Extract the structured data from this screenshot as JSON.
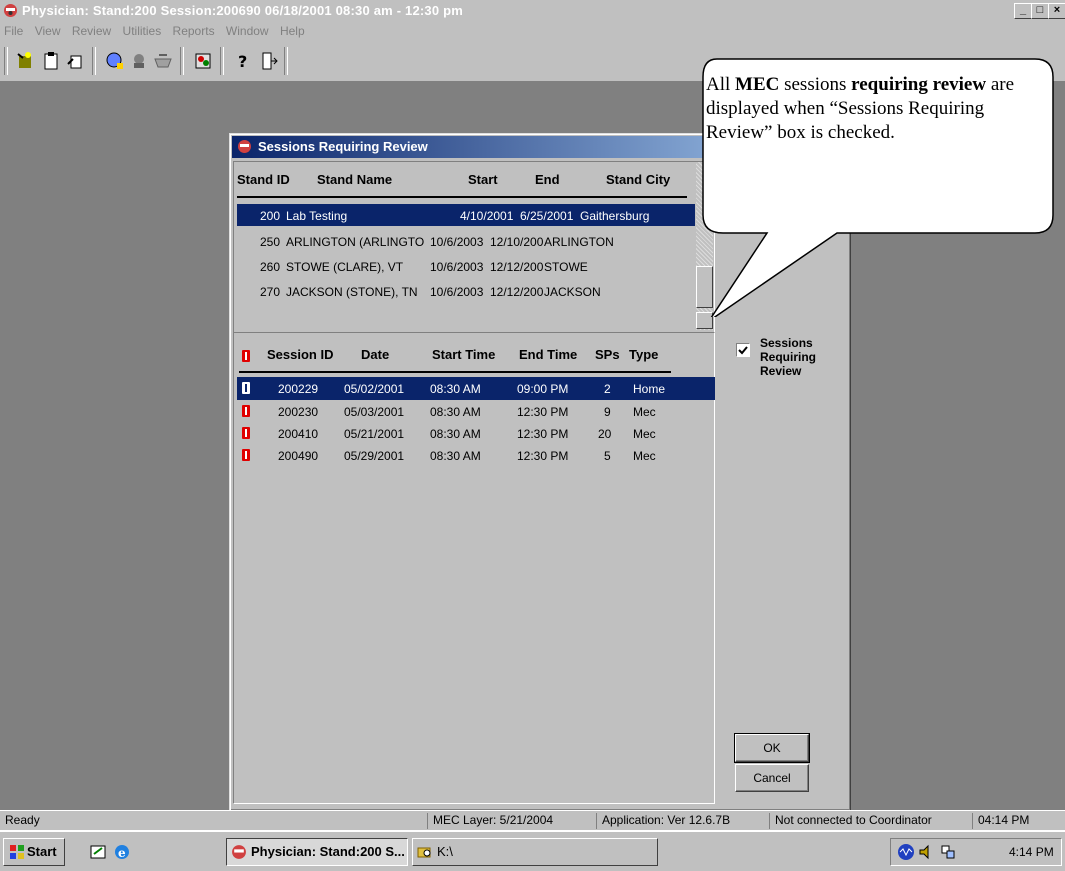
{
  "window": {
    "title": "Physician: Stand:200 Session:200690 06/18/2001 08:30 am - 12:30 pm",
    "min": "_",
    "max": "□",
    "close": "×"
  },
  "menu": [
    "File",
    "View",
    "Review",
    "Utilities",
    "Reports",
    "Window",
    "Help"
  ],
  "dialog": {
    "title": "Sessions Requiring Review",
    "stand_headers": [
      "Stand ID",
      "Stand Name",
      "Start",
      "End",
      "Stand City"
    ],
    "stands": [
      {
        "id": "200",
        "name": "Lab Testing",
        "start": "4/10/2001",
        "end": "6/25/2001",
        "city": "Gaithersburg"
      },
      {
        "id": "250",
        "name": "ARLINGTON (ARLINGTO",
        "start": "10/6/2003",
        "end": "12/10/200",
        "city": "ARLINGTON"
      },
      {
        "id": "260",
        "name": "STOWE (CLARE), VT",
        "start": "10/6/2003",
        "end": "12/12/200",
        "city": "STOWE"
      },
      {
        "id": "270",
        "name": "JACKSON (STONE), TN",
        "start": "10/6/2003",
        "end": "12/12/200",
        "city": "JACKSON"
      }
    ],
    "session_headers": [
      "Session ID",
      "Date",
      "Start Time",
      "End Time",
      "SPs",
      "Type"
    ],
    "sessions": [
      {
        "id": "200229",
        "date": "05/02/2001",
        "start": "08:30 AM",
        "end": "09:00 PM",
        "sps": "2",
        "type": "Home"
      },
      {
        "id": "200230",
        "date": "05/03/2001",
        "start": "08:30 AM",
        "end": "12:30 PM",
        "sps": "9",
        "type": "Mec"
      },
      {
        "id": "200410",
        "date": "05/21/2001",
        "start": "08:30 AM",
        "end": "12:30 PM",
        "sps": "20",
        "type": "Mec"
      },
      {
        "id": "200490",
        "date": "05/29/2001",
        "start": "08:30 AM",
        "end": "12:30 PM",
        "sps": "5",
        "type": "Mec"
      }
    ],
    "checkbox_label": "Sessions Requiring Review",
    "checkbox_checked": true,
    "ok": "OK",
    "cancel": "Cancel"
  },
  "callout": {
    "p1": "All ",
    "b1": "MEC",
    "p2": " sessions ",
    "b2": "requiring review",
    "p3": " are displayed when “Sessions Requiring Review” box is checked."
  },
  "status": {
    "ready": "Ready",
    "layer": "MEC Layer: 5/21/2004",
    "app": "Application: Ver 12.6.7B",
    "conn": "Not connected to Coordinator",
    "time": "04:14 PM"
  },
  "taskbar": {
    "start": "Start",
    "task1": "Physician: Stand:200 S...",
    "task2": "K:\\",
    "clock": "4:14 PM"
  },
  "colors": {
    "selection": "#0a246a",
    "face": "#c0c0c0",
    "desktop": "#808080",
    "book_red": "#e00000"
  }
}
